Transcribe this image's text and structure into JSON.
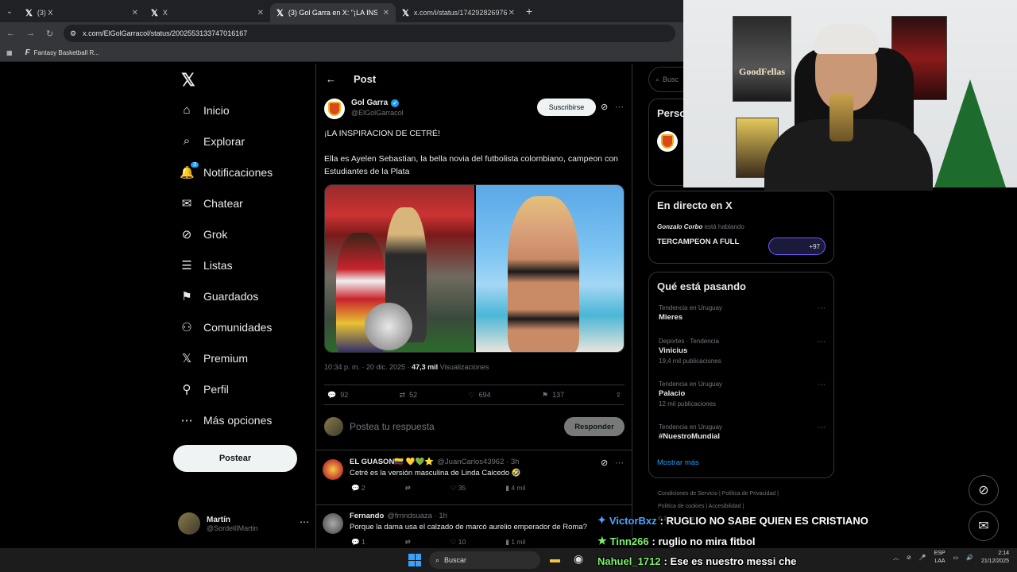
{
  "browser": {
    "tabs": [
      {
        "title": "(3) X",
        "active": false
      },
      {
        "title": "X",
        "active": false
      },
      {
        "title": "(3) Gol Garra en X: \"¡LA INSPIR",
        "active": true
      },
      {
        "title": "x.com/i/status/174292826976",
        "active": false
      }
    ],
    "url": "x.com/ElGolGarracol/status/2002553133747016167",
    "bookmark": "Fantasy Basketball R..."
  },
  "nav": {
    "items": [
      {
        "icon": "⌂",
        "label": "Inicio"
      },
      {
        "icon": "⌕",
        "label": "Explorar"
      },
      {
        "icon": "🔔",
        "label": "Notificaciones",
        "badge": "3"
      },
      {
        "icon": "✉",
        "label": "Chatear"
      },
      {
        "icon": "⊘",
        "label": "Grok"
      },
      {
        "icon": "☰",
        "label": "Listas"
      },
      {
        "icon": "🔖",
        "label": "Guardados"
      },
      {
        "icon": "👥",
        "label": "Comunidades"
      },
      {
        "icon": "𝕏",
        "label": "Premium"
      },
      {
        "icon": "👤",
        "label": "Perfil"
      },
      {
        "icon": "⋯",
        "label": "Más opciones"
      }
    ],
    "post_button": "Postear",
    "user_name": "Martín",
    "user_handle": "@SordellIMartin"
  },
  "post": {
    "header": "Post",
    "author": "Gol Garra",
    "handle": "@ElGolGarracol",
    "subscribe": "Suscribirse",
    "line1": "¡LA INSPIRACION DE CETRÉ!",
    "line2": "Ella es Ayelen Sebastian, la bella novia del futbolista colombiano, campeon con Estudiantes de la Plata",
    "time": "10:34 p. m. · 20 dic. 2025 · ",
    "views_count": "47,3 mil",
    "views_label": " Visualizaciones",
    "replies": "92",
    "reposts": "52",
    "likes": "694",
    "bookmarks": "137",
    "reply_placeholder": "Postea tu respuesta",
    "reply_button": "Responder"
  },
  "comments": [
    {
      "name": "EL GUASON🇨🇴 💛💚⭐",
      "handle": "@JuanCarlos43962 · 3h",
      "text": "Cetré es la versión masculina de Linda Caicedo 🤣",
      "replies": "2",
      "reposts": "",
      "likes": "35",
      "views": "4 mil"
    },
    {
      "name": "Fernando",
      "handle": "@frnndsuaza · 1h",
      "text": "Porque la dama usa el calzado de marcó aurelio emperador de Roma?",
      "replies": "1",
      "reposts": "",
      "likes": "10",
      "views": "1 mil"
    }
  ],
  "right": {
    "search_placeholder": "Busc",
    "persons_title": "Perso",
    "live_title": "En directo en X",
    "live_host": "Gonzalo Corbo",
    "live_status": " está hablando",
    "live_name": "TERCAMPEON A FULL",
    "live_count": "+97",
    "trends_title": "Qué está pasando",
    "trends": [
      {
        "context": "Tendencia en Uruguay",
        "name": "Mieres",
        "posts": ""
      },
      {
        "context": "Deportes · Tendencia",
        "name": "Vinicius",
        "posts": "19,4 mil publicaciones"
      },
      {
        "context": "Tendencia en Uruguay",
        "name": "Palacio",
        "posts": "12 mil publicaciones"
      },
      {
        "context": "Tendencia en Uruguay",
        "name": "#NuestroMundial",
        "posts": ""
      }
    ],
    "show_more": "Mostrar más",
    "footer1": "Condiciones de Servicio  |  Política de Privacidad  |",
    "footer2": "Política de cookies  |  Accesibilidad  |",
    "footer3": "© 2025 X Corp."
  },
  "webcam": {
    "poster1": "GoodFellas"
  },
  "stream_chat": [
    {
      "user": "VictorBxz",
      "text": " : RUGLIO NO SABE QUIEN ES CRISTIANO"
    },
    {
      "user": "Tinn266",
      "text": " : ruglio no mira fitbol"
    },
    {
      "user": "Nahuel_1712",
      "text": " : Ese es nuestro messi che"
    }
  ],
  "taskbar": {
    "search": "Buscar",
    "lang1": "ESP",
    "lang2": "LAA",
    "time": "2:14",
    "date": "21/12/2025"
  }
}
